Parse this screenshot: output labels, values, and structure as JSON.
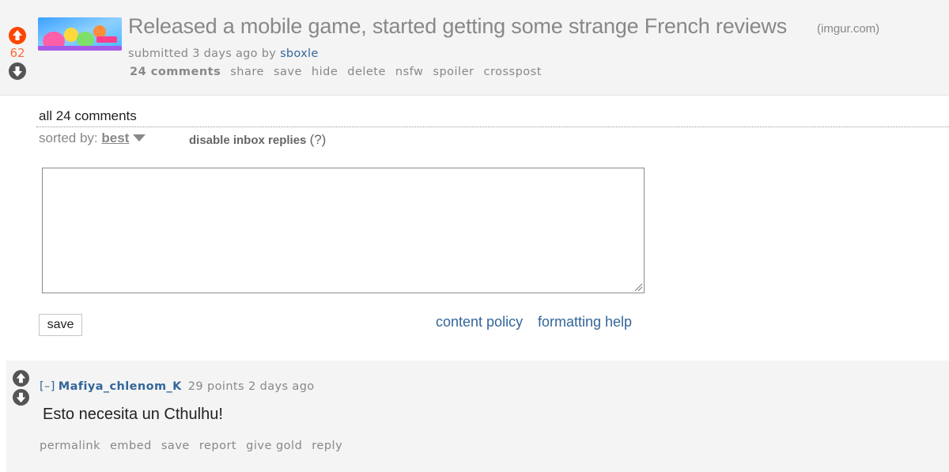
{
  "post": {
    "score": "62",
    "title": "Released a mobile game, started getting some strange French reviews",
    "domain": "(imgur.com)",
    "tagline_prefix": "submitted 3 days ago by",
    "author": "sboxle",
    "actions": {
      "comments": "24 comments",
      "share": "share",
      "save": "save",
      "hide": "hide",
      "delete": "delete",
      "nsfw": "nsfw",
      "spoiler": "spoiler",
      "crosspost": "crosspost"
    },
    "upvote_color": "#ff4500",
    "downvote_color": "#555555"
  },
  "comments_area": {
    "header": "all 24 comments",
    "sorted_label": "sorted by:",
    "sort_value": "best",
    "disable_inbox": "disable inbox replies",
    "help": "(?)",
    "save_label": "save",
    "content_policy": "content policy",
    "formatting_help": "formatting help"
  },
  "comment": {
    "collapse": "[–]",
    "author": "Mafiya_chlenom_K",
    "meta": "29 points 2 days ago",
    "body": "Esto necesita un Cthulhu!",
    "actions": {
      "permalink": "permalink",
      "embed": "embed",
      "save": "save",
      "report": "report",
      "give_gold": "give gold",
      "reply": "reply"
    }
  },
  "colors": {
    "link": "#336699",
    "score": "#ff6a3a",
    "muted": "#888888",
    "panel": "#f4f4f4"
  }
}
